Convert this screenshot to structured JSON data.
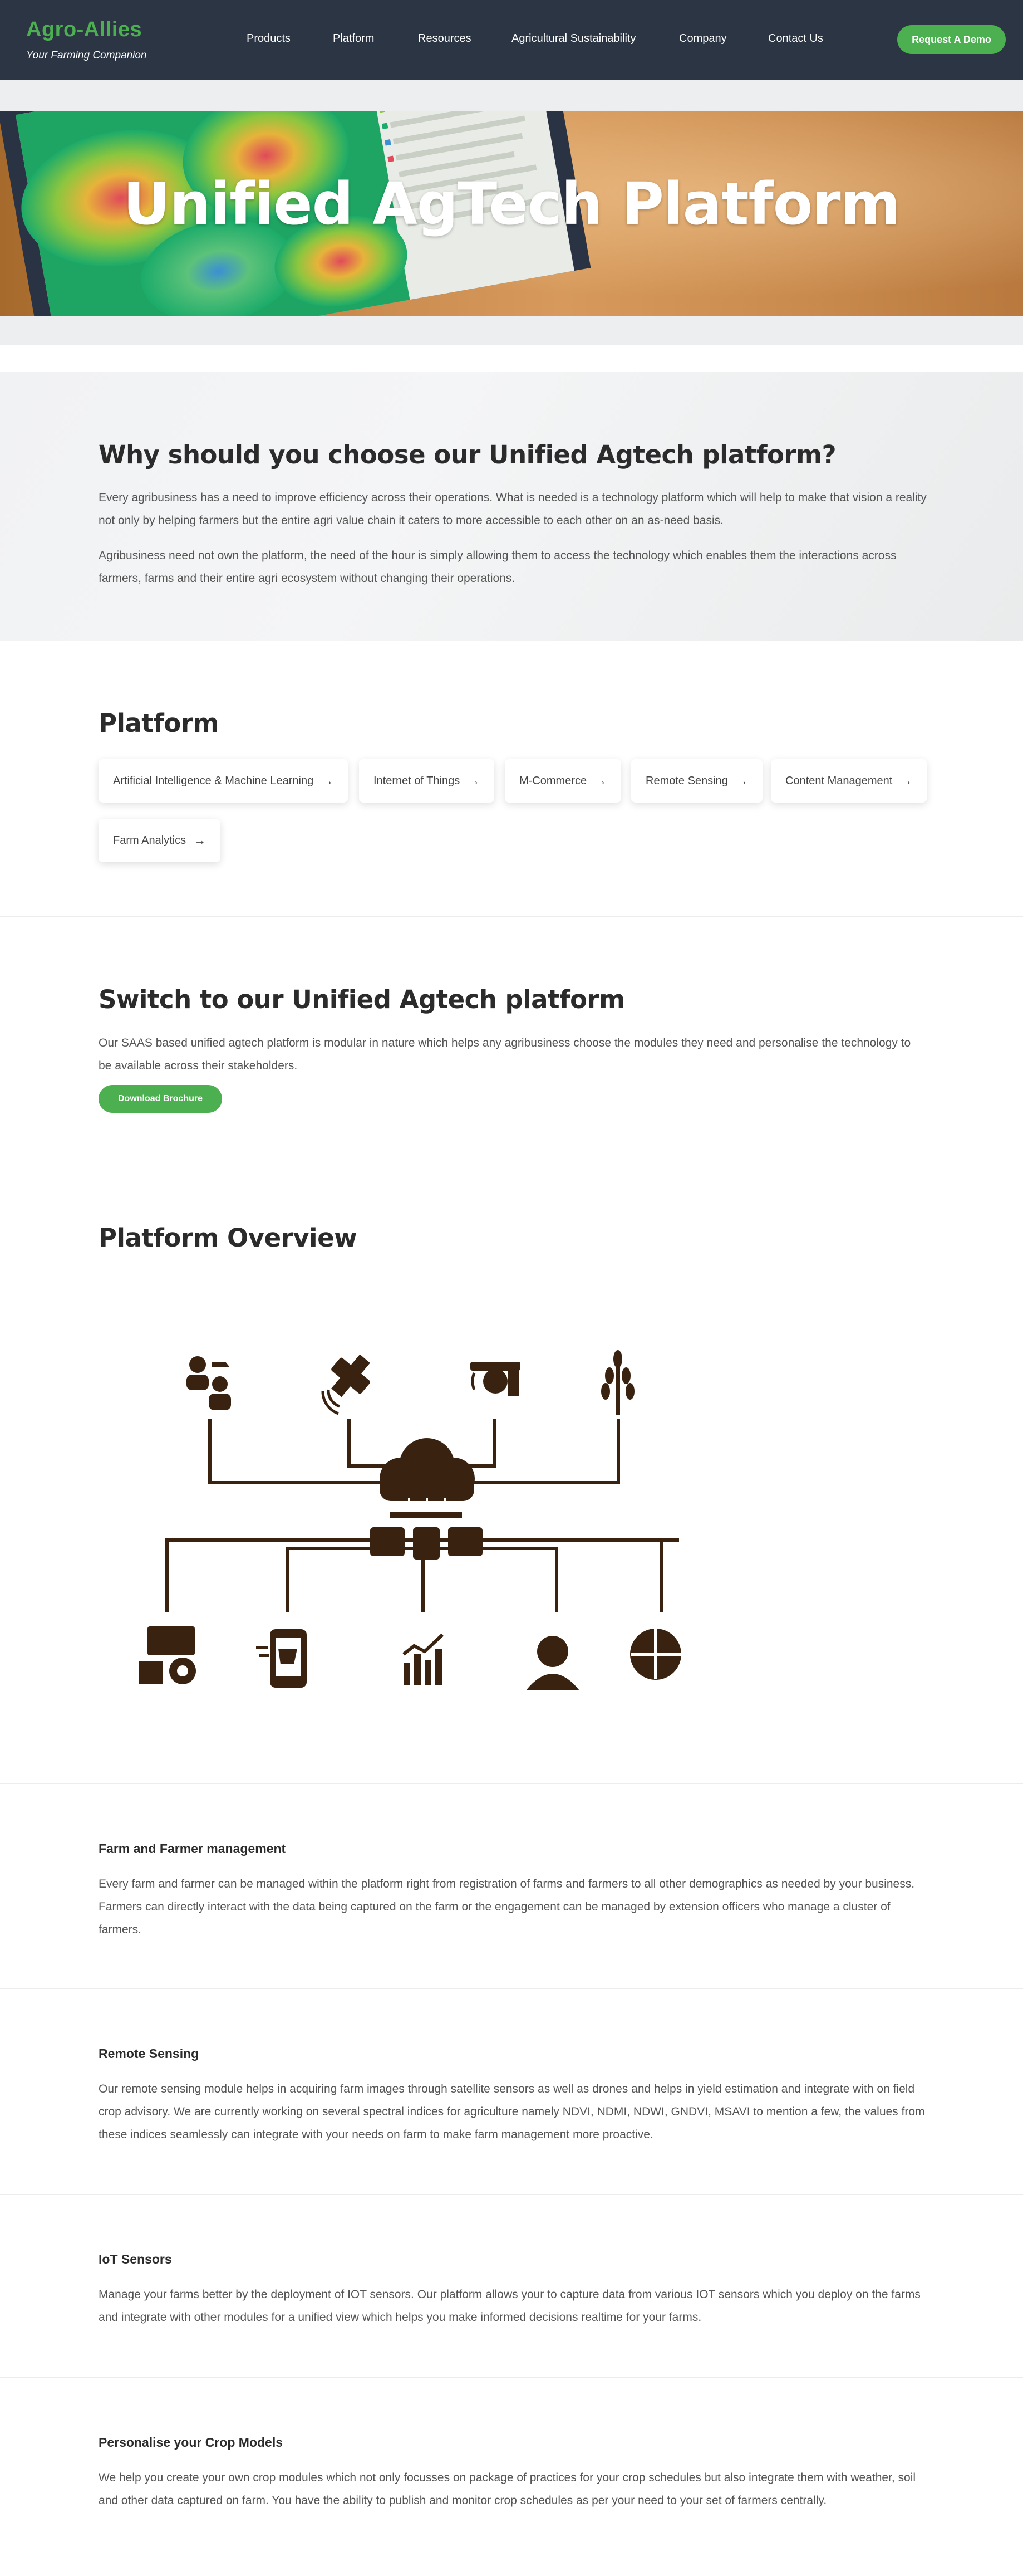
{
  "nav": {
    "brand": "Agro-Allies",
    "tagline": "Your Farming Companion",
    "links": [
      "Products",
      "Platform",
      "Resources",
      "Agricultural Sustainability",
      "Company",
      "Contact Us"
    ],
    "cta": "Request A Demo"
  },
  "hero": {
    "title": "Unified AgTech Platform"
  },
  "why": {
    "title": "Why should you choose our Unified Agtech platform?",
    "para1": "Every agribusiness has a need to improve efficiency across their operations. What is needed is a technology platform which will help to make that vision a reality not only by helping farmers but the entire agri value chain it caters to more accessible to each other on an as-need basis.",
    "para2": "Agribusiness need not own the platform, the need of the hour is simply allowing them to access the technology which enables them the interactions across farmers, farms and their entire agri ecosystem without changing their operations."
  },
  "platform": {
    "title": "Platform",
    "items": [
      "Artificial Intelligence & Machine Learning",
      "Internet of Things",
      "M-Commerce",
      "Remote Sensing",
      "Content Management",
      "Farm Analytics"
    ]
  },
  "switch": {
    "title": "Switch to our Unified Agtech platform",
    "para": "Our SAAS based unified agtech platform is modular in nature which helps any agribusiness choose the modules they need and personalise the technology to be available across their stakeholders.",
    "button": "Download Brochure"
  },
  "overview": {
    "title": "Platform Overview",
    "icon_color": "#3a2210",
    "top_icons": [
      "farmers-icon",
      "satellite-icon",
      "iot-icon",
      "crop-icon"
    ],
    "bottom_icons": [
      "dashboard-icon",
      "mobile-commerce-icon",
      "analytics-icon",
      "support-agent-icon",
      "integration-puzzle-icon"
    ]
  },
  "features": [
    {
      "title": "Farm and Farmer management",
      "text": "Every farm and farmer can be managed within the platform right from registration of farms and farmers to all other demographics as needed by your business. Farmers can directly interact with the data being captured on the farm or the engagement can be managed by extension officers who manage a cluster of farmers."
    },
    {
      "title": "Remote Sensing",
      "text": "Our remote sensing module helps in acquiring farm images through satellite sensors as well as drones and helps in yield estimation and integrate with on field crop advisory. We are currently working on several spectral indices for agriculture namely NDVI, NDMI, NDWI, GNDVI, MSAVI to mention a few, the values from these indices seamlessly can integrate with your needs on farm to make farm management more proactive."
    },
    {
      "title": "IoT Sensors",
      "text": "Manage your farms better by the deployment of IOT sensors. Our platform allows your to capture data from various IOT sensors which you deploy on the farms and integrate with other modules for a unified view which helps you make informed decisions realtime for your farms."
    },
    {
      "title": "Personalise your Crop Models",
      "text": "We help you create your own crop modules which not only focusses on package of practices for your crop schedules but also integrate them with weather, soil and other data captured on farm. You have the ability to publish and monitor crop schedules as per your need to your set of farmers centrally."
    }
  ],
  "colors": {
    "nav_bg": "#2b3544",
    "brand_green": "#4caf50"
  }
}
